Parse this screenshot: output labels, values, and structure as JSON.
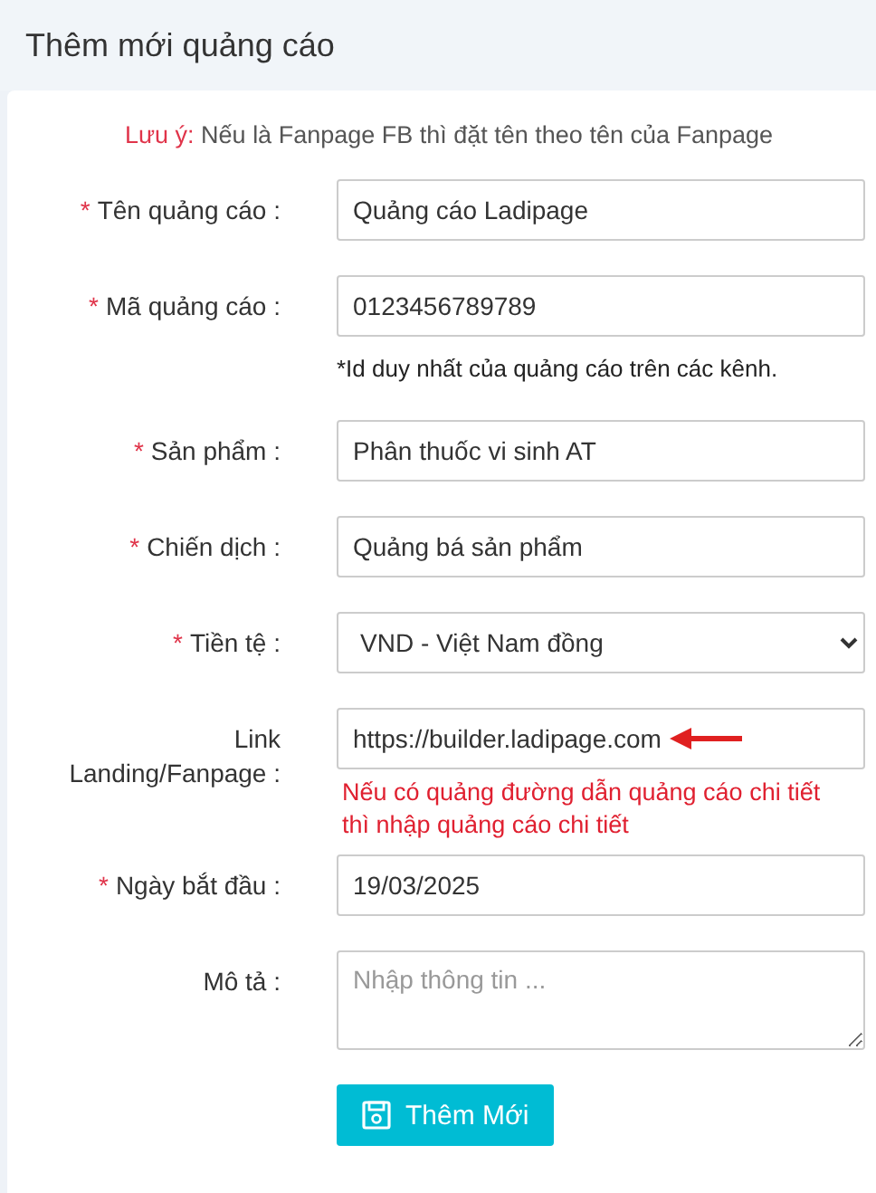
{
  "page_title": "Thêm mới quảng cáo",
  "note": {
    "label": "Lưu ý:",
    "text": "Nếu là Fanpage FB thì đặt tên theo tên của Fanpage"
  },
  "fields": [
    {
      "kind": "text",
      "marker": "*",
      "label": "Tên quảng cáo :",
      "value": "Quảng cáo Ladipage"
    },
    {
      "kind": "text",
      "marker": "*",
      "label": "Mã quảng cáo :",
      "value": "0123456789789",
      "hint": {
        "kind": "info",
        "text": "*Id duy nhất của quảng cáo trên các kênh."
      }
    },
    {
      "kind": "text",
      "marker": "*",
      "label": "Sản phẩm :",
      "value": "Phân thuốc vi sinh AT"
    },
    {
      "kind": "text",
      "marker": "*",
      "label": "Chiến dịch :",
      "value": "Quảng bá sản phẩm"
    },
    {
      "kind": "select",
      "marker": "*",
      "label": "Tiền tệ :",
      "value": "VND - Việt Nam đồng"
    },
    {
      "kind": "text",
      "label": "Link Landing/Fanpage :",
      "value": "https://builder.ladipage.com",
      "pointer": true,
      "hint": {
        "kind": "warning",
        "text": "Nếu có quảng đường dẫn quảng cáo chi tiết thì nhập quảng cáo chi tiết"
      }
    },
    {
      "kind": "text",
      "marker": "*",
      "label": "Ngày bắt đầu :",
      "value": "19/03/2025"
    },
    {
      "kind": "textarea",
      "label": "Mô tả :",
      "placeholder": "Nhập thông tin ..."
    }
  ],
  "submit": {
    "label": "Thêm Mới"
  }
}
